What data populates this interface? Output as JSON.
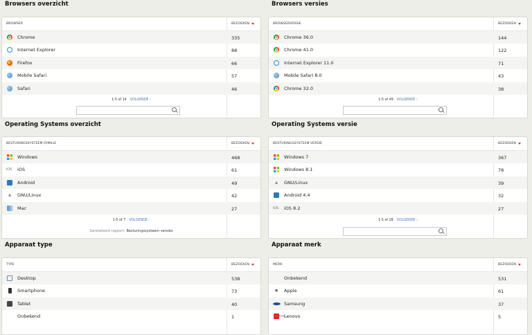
{
  "widgets": [
    {
      "id": "browsers-overview",
      "title": "Browsers overzicht",
      "col1": "BROWSER",
      "col2": "BEZOEKEN",
      "rows": [
        {
          "icon": "chrome",
          "label": "Chrome",
          "value": "335"
        },
        {
          "icon": "ie",
          "label": "Internet Explorer",
          "value": "88"
        },
        {
          "icon": "firefox",
          "label": "Firefox",
          "value": "66"
        },
        {
          "icon": "globe",
          "label": "Mobile Safari",
          "value": "57"
        },
        {
          "icon": "globe",
          "label": "Safari",
          "value": "46"
        }
      ],
      "pager": {
        "range": "1-5 of 14",
        "next": "VOLGENDE ›"
      },
      "search": true
    },
    {
      "id": "browser-versions",
      "title": "Browsers versies",
      "col1": "BROWSERVERSIE",
      "col2": "BEZOEKEN",
      "rows": [
        {
          "icon": "chrome",
          "label": "Chrome 36.0",
          "value": "144"
        },
        {
          "icon": "chrome",
          "label": "Chrome 41.0",
          "value": "122"
        },
        {
          "icon": "ie",
          "label": "Internet Explorer 11.0",
          "value": "71"
        },
        {
          "icon": "globe",
          "label": "Mobile Safari 8.0",
          "value": "43"
        },
        {
          "icon": "chrome",
          "label": "Chrome 32.0",
          "value": "38"
        }
      ],
      "pager": {
        "range": "1-5 of 49",
        "next": "VOLGENDE ›"
      },
      "search": true
    },
    {
      "id": "os-overview",
      "title": "Operating Systems overzicht",
      "col1": "BESTURINGSSYSTEEM FAMILIE",
      "col2": "BEZOEKEN",
      "rows": [
        {
          "icon": "windows",
          "label": "Windows",
          "value": "468"
        },
        {
          "icon": "ios",
          "label": "iOS",
          "value": "61"
        },
        {
          "icon": "android",
          "label": "Android",
          "value": "49"
        },
        {
          "icon": "tux",
          "label": "GNU/Linux",
          "value": "42"
        },
        {
          "icon": "mac",
          "label": "Mac",
          "value": "27"
        }
      ],
      "pager": {
        "range": "1-5 of 7",
        "next": "VOLGENDE ›"
      },
      "related": {
        "prefix": "Gerelateerd rapport:",
        "link": "Besturingssysteem versies"
      }
    },
    {
      "id": "os-version",
      "title": "Operating Systems versie",
      "col1": "BESTURINGSSYSTEEM VERSIE",
      "col2": "BEZOEKEN",
      "rows": [
        {
          "icon": "windows",
          "label": "Windows 7",
          "value": "367"
        },
        {
          "icon": "windows",
          "label": "Windows 8.1",
          "value": "78"
        },
        {
          "icon": "tux",
          "label": "GNU/Linux",
          "value": "39"
        },
        {
          "icon": "android",
          "label": "Android 4.4",
          "value": "32"
        },
        {
          "icon": "ios",
          "label": "iOS 8.2",
          "value": "27"
        }
      ],
      "pager": {
        "range": "1-5 of 28",
        "next": "VOLGENDE ›"
      },
      "search": true
    },
    {
      "id": "device-type",
      "title": "Apparaat type",
      "col1": "TYPE",
      "col2": "BEZOEKEN",
      "rows": [
        {
          "icon": "desktop",
          "label": "Desktop",
          "value": "538"
        },
        {
          "icon": "phone",
          "label": "Smartphone",
          "value": "73"
        },
        {
          "icon": "tablet",
          "label": "Tablet",
          "value": "40"
        },
        {
          "icon": "blank",
          "label": "Onbekend",
          "value": "1"
        }
      ]
    },
    {
      "id": "device-brand",
      "title": "Apparaat merk",
      "col1": "MERK",
      "col2": "BEZOEKEN",
      "rows": [
        {
          "icon": "blank",
          "label": "Onbekend",
          "value": "531"
        },
        {
          "icon": "apple",
          "label": "Apple",
          "value": "61"
        },
        {
          "icon": "samsung",
          "label": "Samsung",
          "value": "37"
        },
        {
          "icon": "lenovo",
          "label": "Lenovo",
          "value": "5"
        }
      ]
    }
  ],
  "icons": {
    "chrome": "chrome-icon",
    "ie": "internet-explorer-icon",
    "firefox": "firefox-icon",
    "globe": "safari-globe-icon",
    "windows": "windows-icon",
    "ios": "ios-icon",
    "android": "android-icon",
    "tux": "linux-tux-icon",
    "mac": "mac-icon",
    "desktop": "desktop-icon",
    "phone": "smartphone-icon",
    "tablet": "tablet-icon",
    "blank": "unknown-icon",
    "apple": "apple-icon",
    "samsung": "samsung-icon",
    "lenovo": "lenovo-icon"
  },
  "colors": {
    "accent": "#4a78b8",
    "sort_arrow": "#d73628",
    "background": "#eeeee8"
  }
}
